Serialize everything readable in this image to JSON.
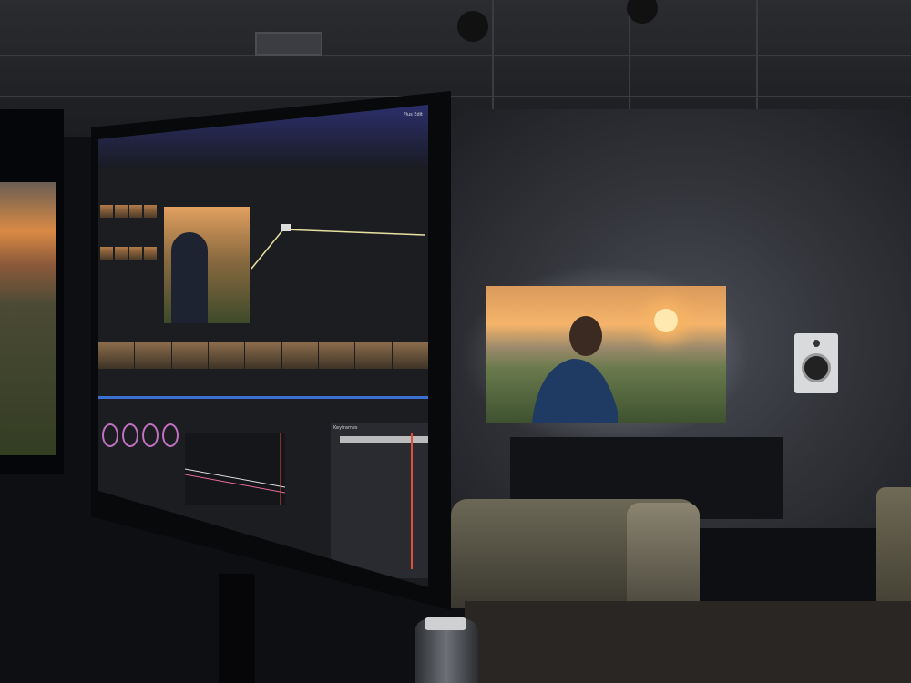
{
  "scene": {
    "room_colors": {
      "ceiling": "#2a2c30",
      "wall": "#33353b",
      "tv_sky": "#f5b46a",
      "ui_accent": "#2b2f6a",
      "playhead": "#e24c3c"
    }
  },
  "grading_monitor": {
    "app_title": "Plus Edit",
    "keyframe_label": "Keyframes"
  }
}
